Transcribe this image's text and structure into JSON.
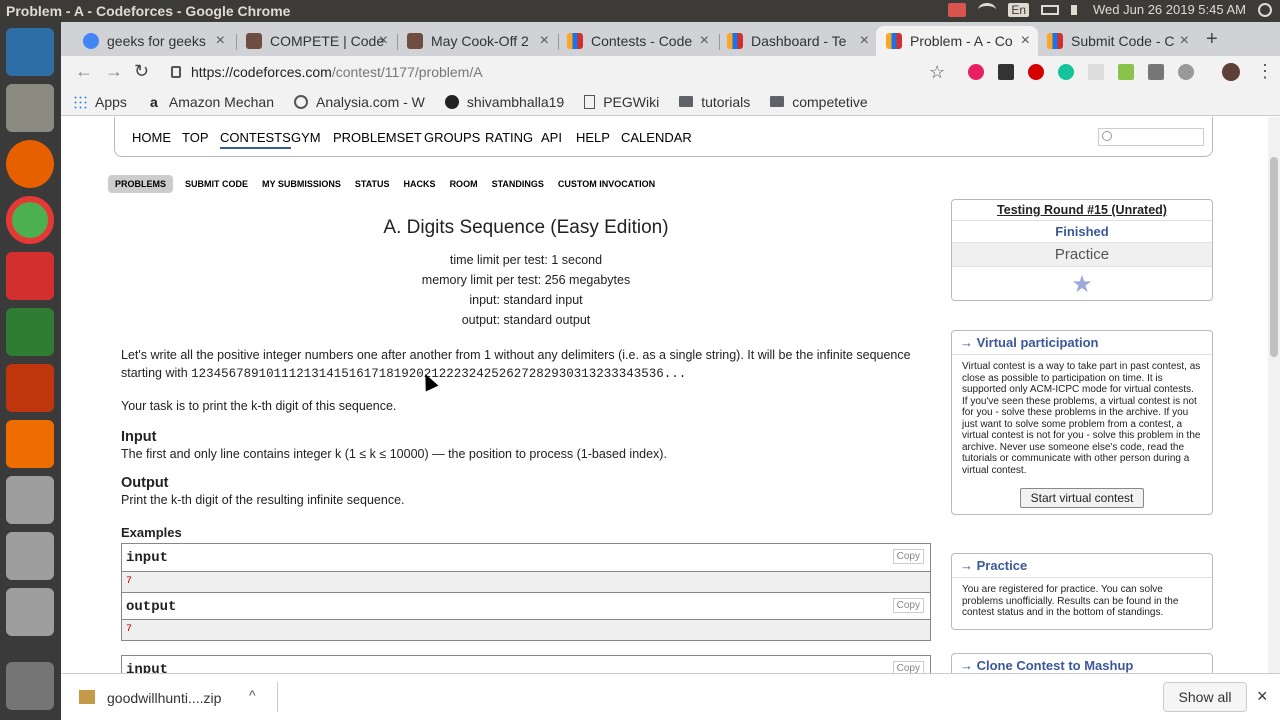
{
  "os": {
    "window_title": "Problem - A - Codeforces - Google Chrome",
    "lang": "En",
    "clock": "Wed Jun 26 2019  5:45 AM"
  },
  "tabs": [
    {
      "label": "geeks for geeks",
      "favicon_color": "#4285f4"
    },
    {
      "label": "COMPETE | Code",
      "favicon_color": "#6d4c41"
    },
    {
      "label": "May Cook-Off 2",
      "favicon_color": "#6d4c41"
    },
    {
      "label": "Contests - Code",
      "favicon_color": "#1a73e8"
    },
    {
      "label": "Dashboard - Te",
      "favicon_color": "#1a73e8"
    },
    {
      "label": "Problem - A - Co",
      "favicon_color": "#1a73e8"
    },
    {
      "label": "Submit Code - C",
      "favicon_color": "#1a73e8"
    }
  ],
  "tab_close": "×",
  "new_tab": "+",
  "address": {
    "host": "https://codeforces.com",
    "path": "/contest/1177/problem/A"
  },
  "bookmarks": [
    {
      "label": "Apps",
      "icon": "apps-grid-icon"
    },
    {
      "label": "Amazon Mechan",
      "icon": "amazon-icon"
    },
    {
      "label": "Analysia.com - W",
      "icon": "analysia-icon"
    },
    {
      "label": "shivambhalla19",
      "icon": "github-icon"
    },
    {
      "label": "PEGWiki",
      "icon": "page-icon"
    },
    {
      "label": "tutorials",
      "icon": "folder-icon"
    },
    {
      "label": "competetive",
      "icon": "folder-icon"
    }
  ],
  "main_menu": [
    "HOME",
    "TOP",
    "CONTESTS",
    "GYM",
    "PROBLEMSET",
    "GROUPS",
    "RATING",
    "API",
    "HELP",
    "CALENDAR"
  ],
  "second_menu": [
    "PROBLEMS",
    "SUBMIT CODE",
    "MY SUBMISSIONS",
    "STATUS",
    "HACKS",
    "ROOM",
    "STANDINGS",
    "CUSTOM INVOCATION"
  ],
  "problem": {
    "title": "A. Digits Sequence (Easy Edition)",
    "time_limit": "time limit per test: 1 second",
    "memory_limit": "memory limit per test: 256 megabytes",
    "input_file": "input: standard input",
    "output_file": "output: standard output",
    "legend_1": "Let's write all the positive integer numbers one after another from 1 without any delimiters (i.e. as a single string). It will be the infinite sequence starting with ",
    "legend_seq": "123456789101112131415161718192021222324252627282930313233343536...",
    "legend_2": "Your task is to print the k-th digit of this sequence.",
    "input_title": "Input",
    "input_body": "The first and only line contains integer k (1 ≤ k ≤ 10000) — the position to process (1-based index).",
    "output_title": "Output",
    "output_body": "Print the k-th digit of the resulting infinite sequence.",
    "examples_title": "Examples",
    "samples": [
      {
        "input_label": "input",
        "input_value": "7",
        "output_label": "output",
        "output_value": "7",
        "copy": "Copy"
      }
    ],
    "next_input_label": "input",
    "next_copy": "Copy"
  },
  "sidebar": {
    "round_name": "Testing Round #15 (Unrated)",
    "status": "Finished",
    "mode": "Practice",
    "virtual_title": "→ Virtual participation",
    "virtual_text": "Virtual contest is a way to take part in past contest, as close as possible to participation on time. It is supported only ACM-ICPC mode for virtual contests. If you've seen these problems, a virtual contest is not for you - solve these problems in the archive. If you just want to solve some problem from a contest, a virtual contest is not for you - solve this problem in the archive. Never use someone else's code, read the tutorials or communicate with other person during a virtual contest.",
    "virtual_button": "Start virtual contest",
    "practice_title": "→ Practice",
    "practice_text": "You are registered for practice. You can solve problems unofficially. Results can be found in the contest status and in the bottom of standings.",
    "clone_title": "→ Clone Contest to Mashup"
  },
  "download": {
    "filename": "goodwillhunti....zip",
    "show_all": "Show all",
    "close": "×"
  }
}
